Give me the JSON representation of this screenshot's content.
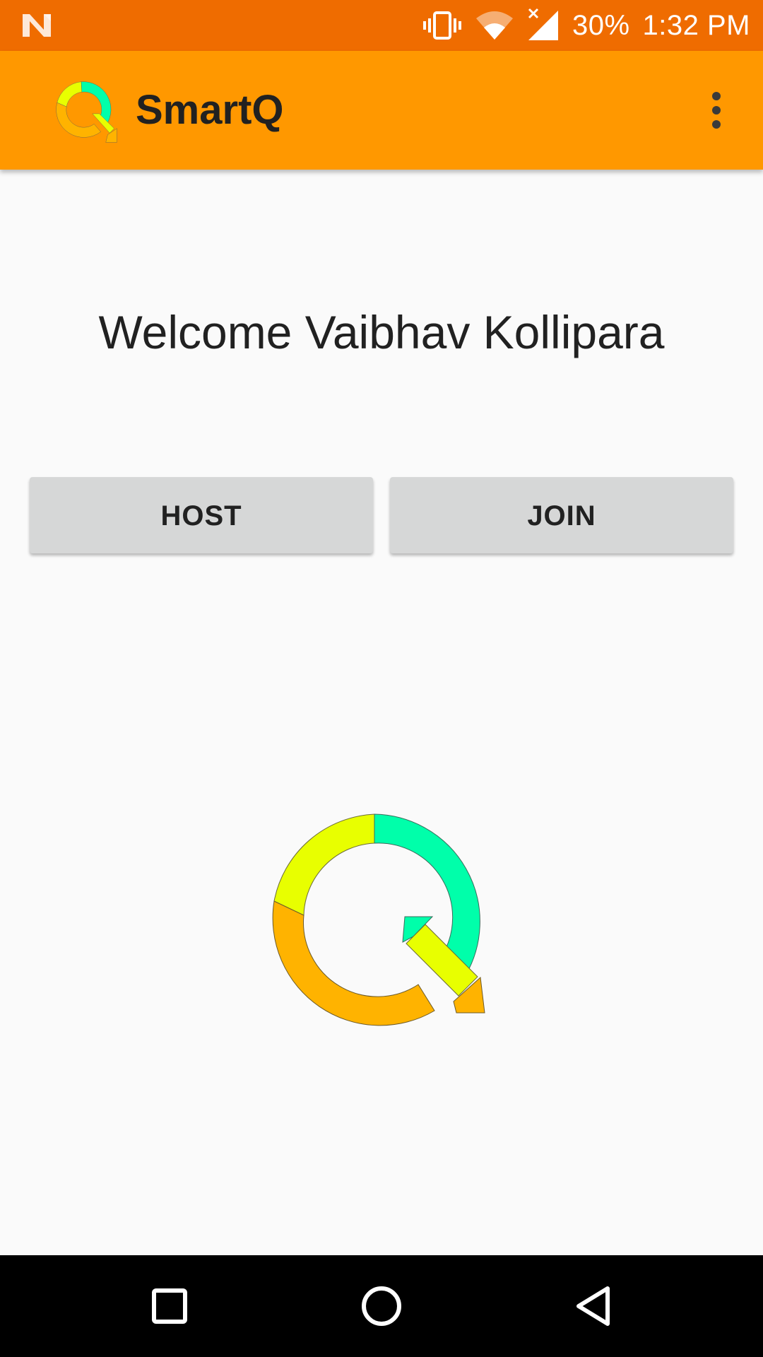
{
  "status_bar": {
    "notification_icon": "n-icon",
    "icons": [
      "vibrate-icon",
      "wifi-icon",
      "signal-no-data-icon"
    ],
    "battery": "30%",
    "time": "1:32 PM"
  },
  "app_bar": {
    "title": "SmartQ",
    "logo_icon": "smartq-logo-icon",
    "menu_icon": "more-vertical-icon"
  },
  "main": {
    "welcome_text": "Welcome Vaibhav Kollipara",
    "buttons": {
      "host_label": "HOST",
      "join_label": "JOIN"
    },
    "logo_icon": "smartq-logo-icon"
  },
  "nav_bar": {
    "recents_icon": "recents-square-icon",
    "home_icon": "home-circle-icon",
    "back_icon": "back-triangle-icon"
  },
  "colors": {
    "status_bar": "#ef6c00",
    "app_bar": "#ff9800",
    "background": "#fafafa",
    "button": "#d6d7d7",
    "logo_yellow": "#e8ff00",
    "logo_green": "#00ffaa",
    "logo_orange": "#ffb300",
    "nav_bar": "#000000"
  }
}
